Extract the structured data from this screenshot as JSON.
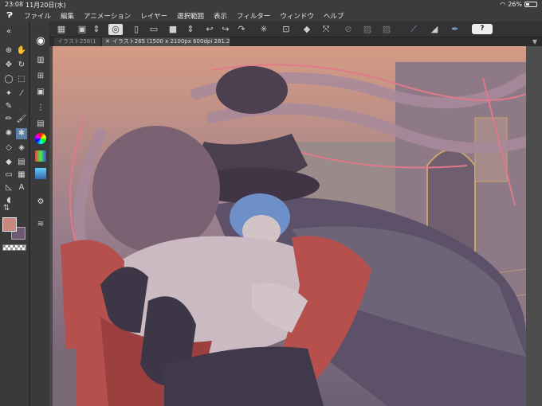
{
  "status_bar": {
    "time": "23:08",
    "date": "11月20日(水)",
    "battery_percent": "26%",
    "battery_level": 0.26
  },
  "menu": {
    "app_logo": "Ɂ",
    "items": [
      "ファイル",
      "編集",
      "アニメーション",
      "レイヤー",
      "選択範囲",
      "表示",
      "フィルター",
      "ウィンドウ",
      "ヘルプ"
    ]
  },
  "toolbar": {
    "icons": [
      "grid-icon",
      "canvas-icon",
      "updown-icon",
      "eye-icon",
      "new-file-icon",
      "open-folder-icon",
      "save-icon",
      "updown-icon",
      "undo-icon",
      "redo-icon",
      "redo-alt-icon",
      "loading-icon",
      "zoom-icon",
      "erase-icon",
      "transform-icon",
      "lasso-icon",
      "ruler-icon",
      "perspective-icon",
      "pen-icon",
      "blend-icon",
      "brush-icon"
    ],
    "help_label": "?"
  },
  "tabs": [
    {
      "label": "イラスト258(1",
      "active": false
    },
    {
      "label": "イラスト265 (1500 x 2100px 600dpi 281.2%)",
      "active": true
    }
  ],
  "colors": {
    "main_color": "#c7887e",
    "sub_color": "#6d5a72",
    "app_bg": "#4a4a4a",
    "menubar_bg": "#3c3c3c"
  }
}
